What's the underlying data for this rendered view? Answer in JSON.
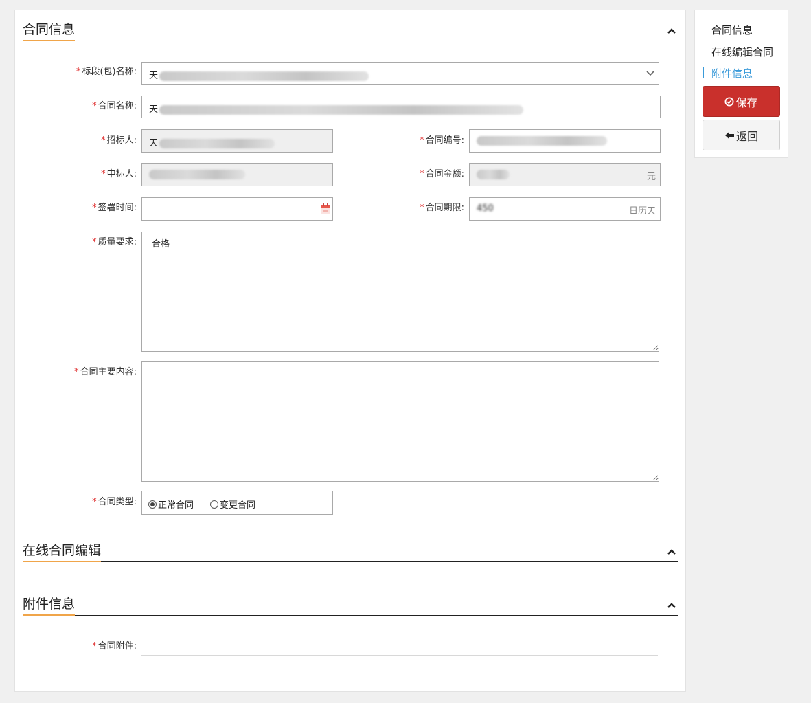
{
  "sections": {
    "contract_info": "合同信息",
    "online_edit": "在线合同编辑",
    "attachment": "附件信息"
  },
  "form": {
    "required_mark": "*",
    "bid_section": {
      "label": "标段(包)名称:",
      "value": "天"
    },
    "contract_name": {
      "label": "合同名称:",
      "value": "天"
    },
    "tenderer": {
      "label": "招标人:",
      "value": "天"
    },
    "contract_no": {
      "label": "合同编号:",
      "value": ""
    },
    "winner": {
      "label": "中标人:",
      "value": ""
    },
    "amount": {
      "label": "合同金额:",
      "unit": "元"
    },
    "sign_time": {
      "label": "签署时间:",
      "value": ""
    },
    "term": {
      "label": "合同期限:",
      "value": "450",
      "unit": "日历天"
    },
    "quality": {
      "label": "质量要求:",
      "value": "合格"
    },
    "main_content": {
      "label": "合同主要内容:",
      "value": ""
    },
    "contract_type": {
      "label": "合同类型:",
      "options": [
        "正常合同",
        "变更合同"
      ],
      "selected": "正常合同"
    },
    "attachment": {
      "label": "合同附件:"
    }
  },
  "side_nav": {
    "items": [
      "合同信息",
      "在线编辑合同",
      "附件信息"
    ],
    "active_index": 2,
    "save_label": "保存",
    "back_label": "返回"
  },
  "colors": {
    "accent_underline": "#f0a54a",
    "save_button": "#c9302c",
    "active_nav": "#3a9ad9",
    "required": "#e03030"
  }
}
